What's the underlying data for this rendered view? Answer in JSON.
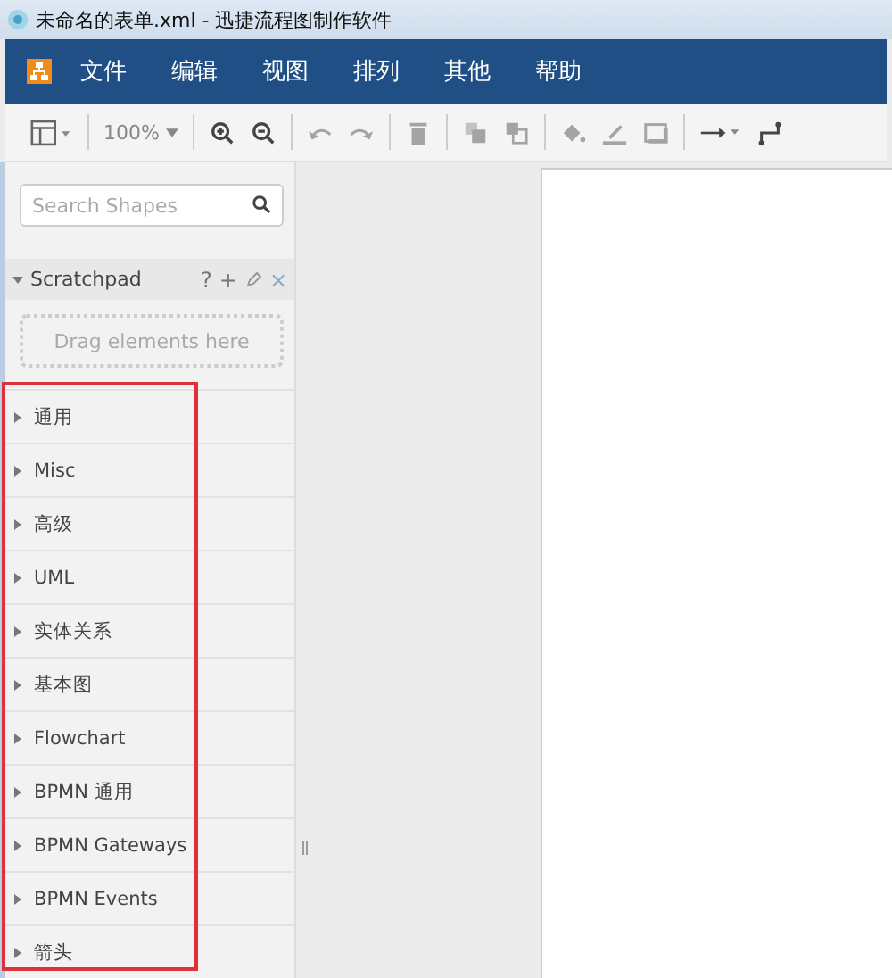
{
  "window": {
    "title": "未命名的表单.xml - 迅捷流程图制作软件"
  },
  "menu": [
    "文件",
    "编辑",
    "视图",
    "排列",
    "其他",
    "帮助"
  ],
  "toolbar": [
    {
      "kind": "layout",
      "disabled": false
    },
    {
      "kind": "sep"
    },
    {
      "kind": "zoom",
      "label": "100%",
      "disabled": false
    },
    {
      "kind": "sep"
    },
    {
      "kind": "zoom-in",
      "disabled": false
    },
    {
      "kind": "zoom-out",
      "disabled": false
    },
    {
      "kind": "sep"
    },
    {
      "kind": "undo",
      "disabled": true
    },
    {
      "kind": "redo",
      "disabled": true
    },
    {
      "kind": "sep"
    },
    {
      "kind": "delete",
      "disabled": true
    },
    {
      "kind": "sep"
    },
    {
      "kind": "to-front",
      "disabled": true
    },
    {
      "kind": "to-back",
      "disabled": true
    },
    {
      "kind": "sep"
    },
    {
      "kind": "fill",
      "disabled": true
    },
    {
      "kind": "line",
      "disabled": true
    },
    {
      "kind": "shadow",
      "disabled": true
    },
    {
      "kind": "sep"
    },
    {
      "kind": "connection",
      "disabled": false
    },
    {
      "kind": "waypoints",
      "disabled": false
    }
  ],
  "sidebar": {
    "search": {
      "placeholder": "Search Shapes"
    },
    "scratchpad": {
      "title": "Scratchpad",
      "expanded": true,
      "help": "?",
      "add": "+",
      "close": "×",
      "drop_hint": "Drag elements here"
    },
    "categories": [
      {
        "label": "通用",
        "expanded": false
      },
      {
        "label": "Misc",
        "expanded": false
      },
      {
        "label": "高级",
        "expanded": false
      },
      {
        "label": "UML",
        "expanded": false
      },
      {
        "label": "实体关系",
        "expanded": false
      },
      {
        "label": "基本图",
        "expanded": false
      },
      {
        "label": "Flowchart",
        "expanded": false
      },
      {
        "label": "BPMN 通用",
        "expanded": false
      },
      {
        "label": "BPMN Gateways",
        "expanded": false
      },
      {
        "label": "BPMN Events",
        "expanded": false
      },
      {
        "label": "箭头",
        "expanded": false
      }
    ]
  }
}
